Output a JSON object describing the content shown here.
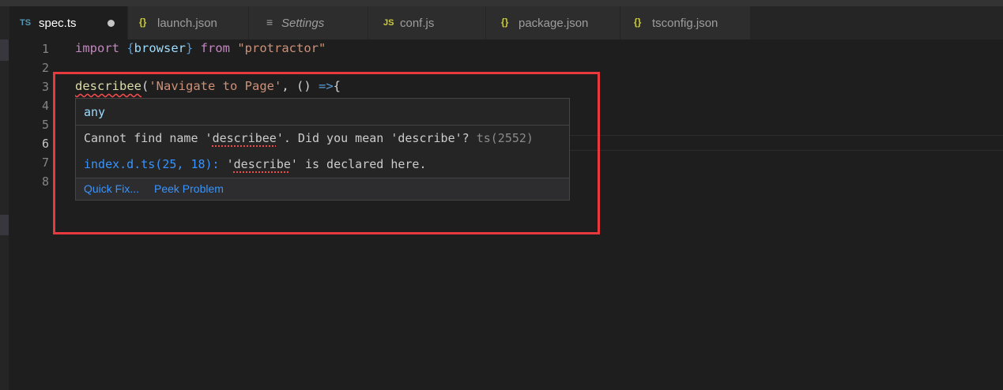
{
  "tabs": [
    {
      "icon": "TS",
      "icon_name": "typescript-file-icon",
      "label": "spec.ts",
      "active": true,
      "dirty": true
    },
    {
      "icon": "{}",
      "icon_name": "json-file-icon",
      "label": "launch.json"
    },
    {
      "icon": "≡",
      "icon_name": "settings-file-icon",
      "label": "Settings"
    },
    {
      "icon": "JS",
      "icon_name": "javascript-file-icon",
      "label": "conf.js"
    },
    {
      "icon": "{}",
      "icon_name": "json-file-icon",
      "label": "package.json"
    },
    {
      "icon": "{}",
      "icon_name": "json-file-icon",
      "label": "tsconfig.json"
    }
  ],
  "editor": {
    "line_numbers": [
      "1",
      "2",
      "3",
      "4",
      "5",
      "6",
      "7",
      "8"
    ],
    "current_line": "6",
    "line1": {
      "kw1": "import",
      "brace_open": " {",
      "name": "browser",
      "brace_close": "} ",
      "kw2": "from",
      "space": " ",
      "module": "\"protractor\""
    },
    "line3": {
      "fn": "describee",
      "paren": "(",
      "str": "'Navigate to Page'",
      "rest": ", () ",
      "arrow": "=>",
      "brace": "{"
    }
  },
  "hover": {
    "type": "any",
    "message_pre": "Cannot find name '",
    "message_name": "describee",
    "message_post": "'. Did you mean 'describe'? ",
    "message_code": "ts(2552)",
    "related_link": "index.d.ts(25, 18):",
    "related_pre": " '",
    "related_name": "describe",
    "related_post": "' is declared here.",
    "actions": [
      "Quick Fix...",
      "Peek Problem"
    ]
  },
  "colors": {
    "editor_bg": "#1e1e1e",
    "error": "#f14c4c",
    "link": "#3794ff",
    "highlight_box": "#e8393f"
  }
}
